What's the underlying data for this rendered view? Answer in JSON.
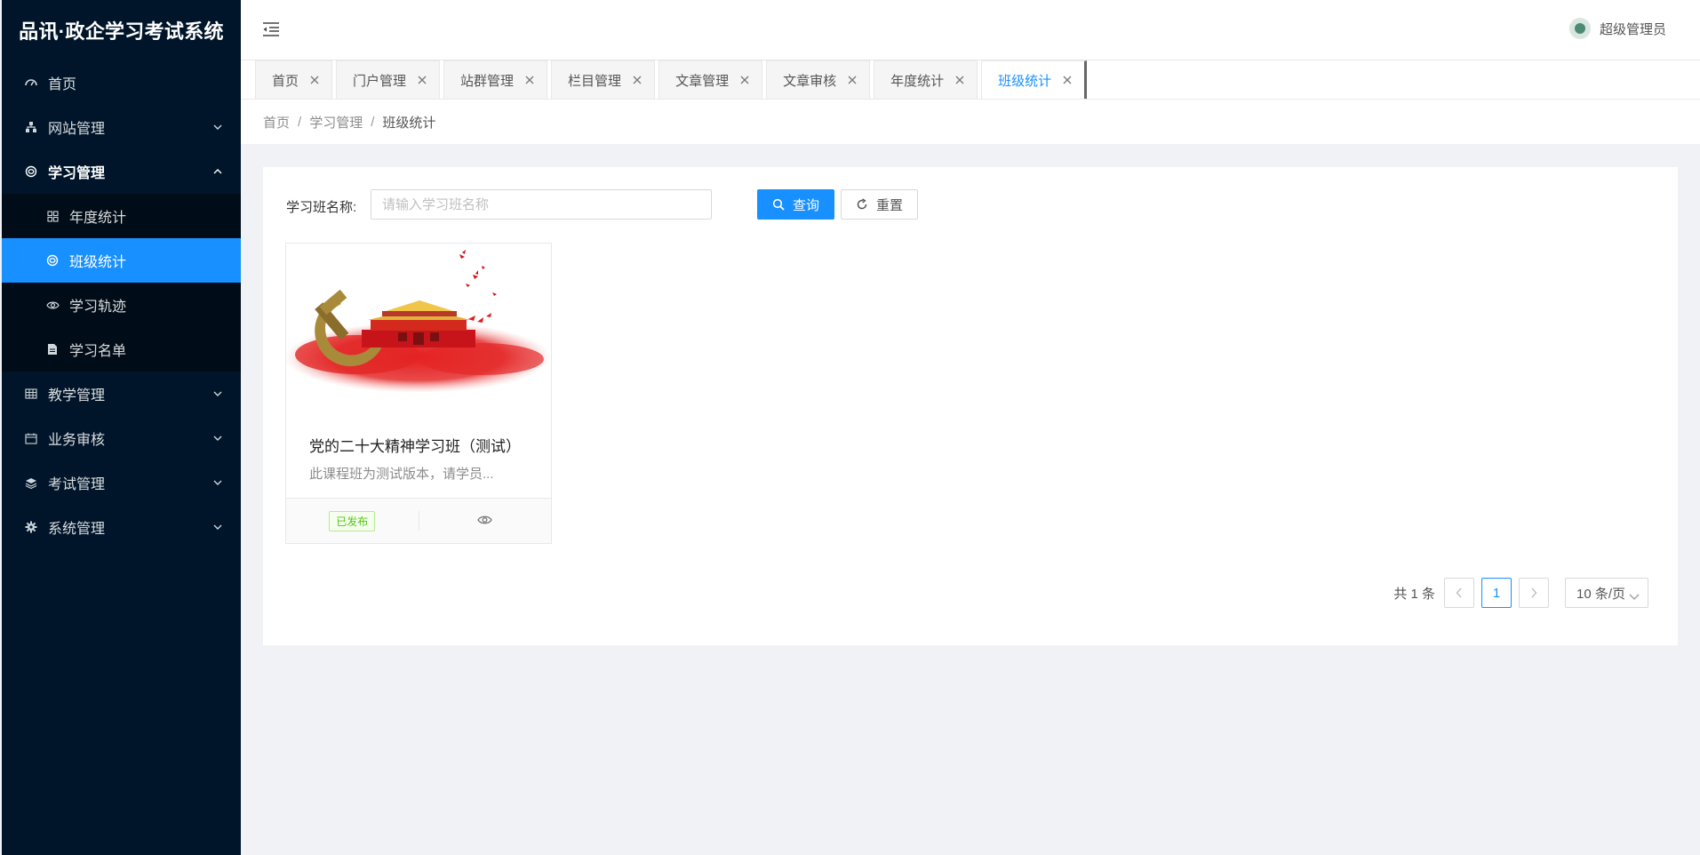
{
  "app": {
    "title": "品讯·政企学习考试系统"
  },
  "sidebar": {
    "items": [
      {
        "label": "首页",
        "icon": "dashboard-icon"
      },
      {
        "label": "网站管理",
        "icon": "cluster-icon"
      },
      {
        "label": "学习管理",
        "icon": "study-icon"
      },
      {
        "label": "教学管理",
        "icon": "table-icon"
      },
      {
        "label": "业务审核",
        "icon": "calendar-icon"
      },
      {
        "label": "考试管理",
        "icon": "layers-icon"
      },
      {
        "label": "系统管理",
        "icon": "gear-icon"
      }
    ],
    "submenu": [
      {
        "label": "年度统计",
        "icon": "appstore-icon"
      },
      {
        "label": "班级统计",
        "icon": "study-icon"
      },
      {
        "label": "学习轨迹",
        "icon": "eye-icon"
      },
      {
        "label": "学习名单",
        "icon": "file-icon"
      }
    ]
  },
  "header": {
    "user": "超级管理员"
  },
  "tabs": [
    "首页",
    "门户管理",
    "站群管理",
    "栏目管理",
    "文章管理",
    "文章审核",
    "年度统计",
    "班级统计"
  ],
  "breadcrumb": [
    "首页",
    "学习管理",
    "班级统计"
  ],
  "search": {
    "label": "学习班名称:",
    "placeholder": "请输入学习班名称",
    "query_label": "查询",
    "reset_label": "重置"
  },
  "cards": [
    {
      "title": "党的二十大精神学习班（测试）",
      "desc": "此课程班为测试版本，请学员...",
      "status": "已发布"
    }
  ],
  "pagination": {
    "total": "共 1 条",
    "current": "1",
    "page_size": "10 条/页"
  },
  "colors": {
    "sidebar": "#001529",
    "primary": "#1890ff",
    "success": "#52c41a"
  }
}
